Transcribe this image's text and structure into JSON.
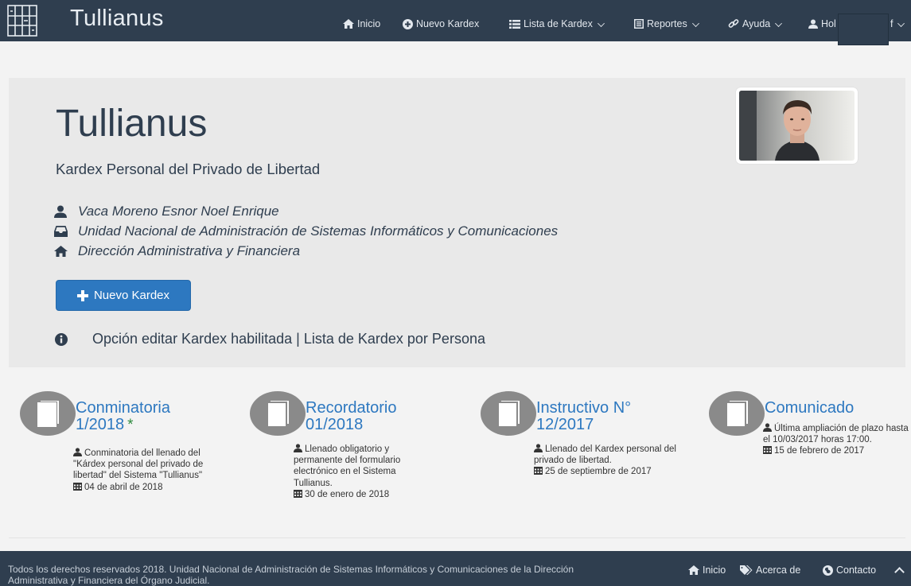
{
  "navbar": {
    "brand": "Tullianus",
    "items": [
      {
        "label": "Inicio",
        "icon": "home-icon"
      },
      {
        "label": "Nuevo Kardex",
        "icon": "plus-circle-icon"
      },
      {
        "label": "Lista de Kardex",
        "icon": "list-icon"
      },
      {
        "label": "Reportes",
        "icon": "report-icon"
      },
      {
        "label": "Ayuda",
        "icon": "link-icon"
      },
      {
        "label": "Hol",
        "icon": "user-icon"
      }
    ],
    "user_tail": "f"
  },
  "hero": {
    "title": "Tullianus",
    "subtitle": "Kardex Personal del Privado de Libertad",
    "person": "Vaca Moreno Esnor Noel Enrique",
    "unit": "Unidad Nacional de Administración de Sistemas Informáticos y Comunicaciones",
    "direction": "Dirección Administrativa y Financiera",
    "new_button": "Nuevo Kardex",
    "notice": "Opción editar Kardex habilitada | Lista de Kardex por Persona"
  },
  "news": [
    {
      "title": "Conminatoria 1/2018",
      "starred": "*",
      "body": "Conminatoria del llenado del \"Kárdex personal del privado de libertad\" del Sistema \"Tullianus\"",
      "date": "04 de abril de 2018"
    },
    {
      "title": "Recordatorio 01/2018",
      "body": "Llenado obligatorio y permanente del formulario electrónico en el Sistema Tullianus.",
      "date": "30 de enero de 2018"
    },
    {
      "title": "Instructivo N° 12/2017",
      "body": "Llenado del Kardex personal del privado de libertad.",
      "date": "25 de septiembre de 2017"
    },
    {
      "title": "Comunicado",
      "body": "Última ampliación de plazo hasta el 10/03/2017 horas 17:00.",
      "date": "15 de febrero de 2017"
    }
  ],
  "footer": {
    "copyright": "Todos los derechos reservados 2018. Unidad Nacional de Administración de Sistemas Informáticos y Comunicaciones de la Dirección Administrativa y Financiera del Órgano Judicial.",
    "links": [
      "Inicio",
      "Acerca de",
      "Contacto"
    ]
  },
  "colors": {
    "navbar": "#2f3e4f",
    "accent": "#2d78c0",
    "star": "#2e8b3e"
  }
}
